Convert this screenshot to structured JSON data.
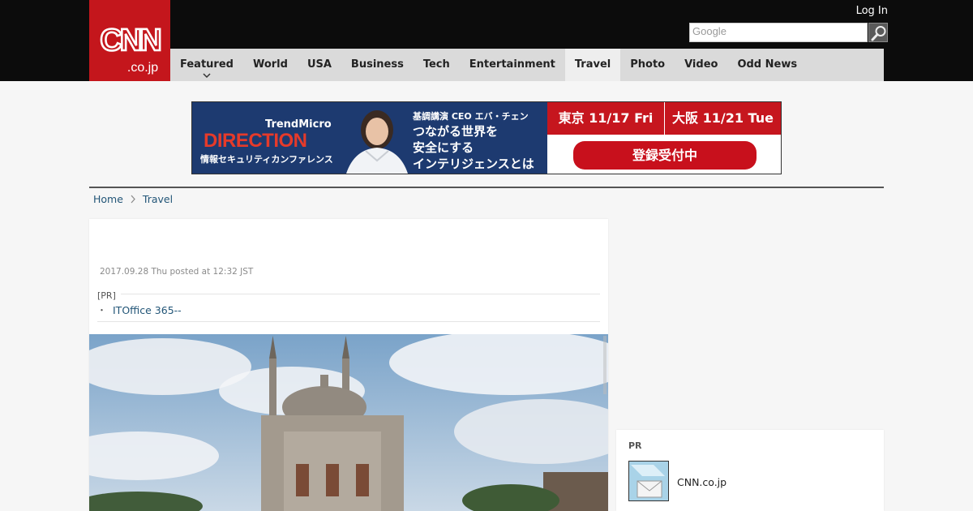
{
  "header": {
    "logo_text": "CNN.co.jp",
    "login_label": "Log In",
    "search_placeholder": "Google"
  },
  "nav": {
    "items": [
      {
        "label": "Featured",
        "active": false,
        "has_dropdown": true
      },
      {
        "label": "World",
        "active": false
      },
      {
        "label": "USA",
        "active": false
      },
      {
        "label": "Business",
        "active": false
      },
      {
        "label": "Tech",
        "active": false
      },
      {
        "label": "Entertainment",
        "active": false
      },
      {
        "label": "Travel",
        "active": true
      },
      {
        "label": "Photo",
        "active": false
      },
      {
        "label": "Video",
        "active": false
      },
      {
        "label": "Odd News",
        "active": false
      }
    ]
  },
  "banner": {
    "brand": "TrendMicro",
    "event": "DIRECTION",
    "subtitle": "情報セキュリティカンファレンス",
    "speaker": "基調講演 CEO エバ・チェン",
    "copy_line1": "つながる世界を",
    "copy_line2": "安全にする",
    "copy_line3": "インテリジェンスとは",
    "date_tokyo": "東京 11/17 Fri",
    "date_osaka": "大阪 11/21 Tue",
    "register_label": "登録受付中"
  },
  "breadcrumb": {
    "home": "Home",
    "current": "Travel"
  },
  "article": {
    "posted": "2017.09.28 Thu posted at 12:32 JST",
    "pr_label": "[PR]",
    "pr_bullet": "・",
    "pr_link": "ITOffice 365--"
  },
  "sidebar_pr": {
    "label": "PR",
    "title": "CNN.co.jp"
  },
  "colors": {
    "brand_red": "#c4161c",
    "header_bg": "#0c0c0c",
    "nav_bg": "#dadada",
    "link": "#225577"
  }
}
